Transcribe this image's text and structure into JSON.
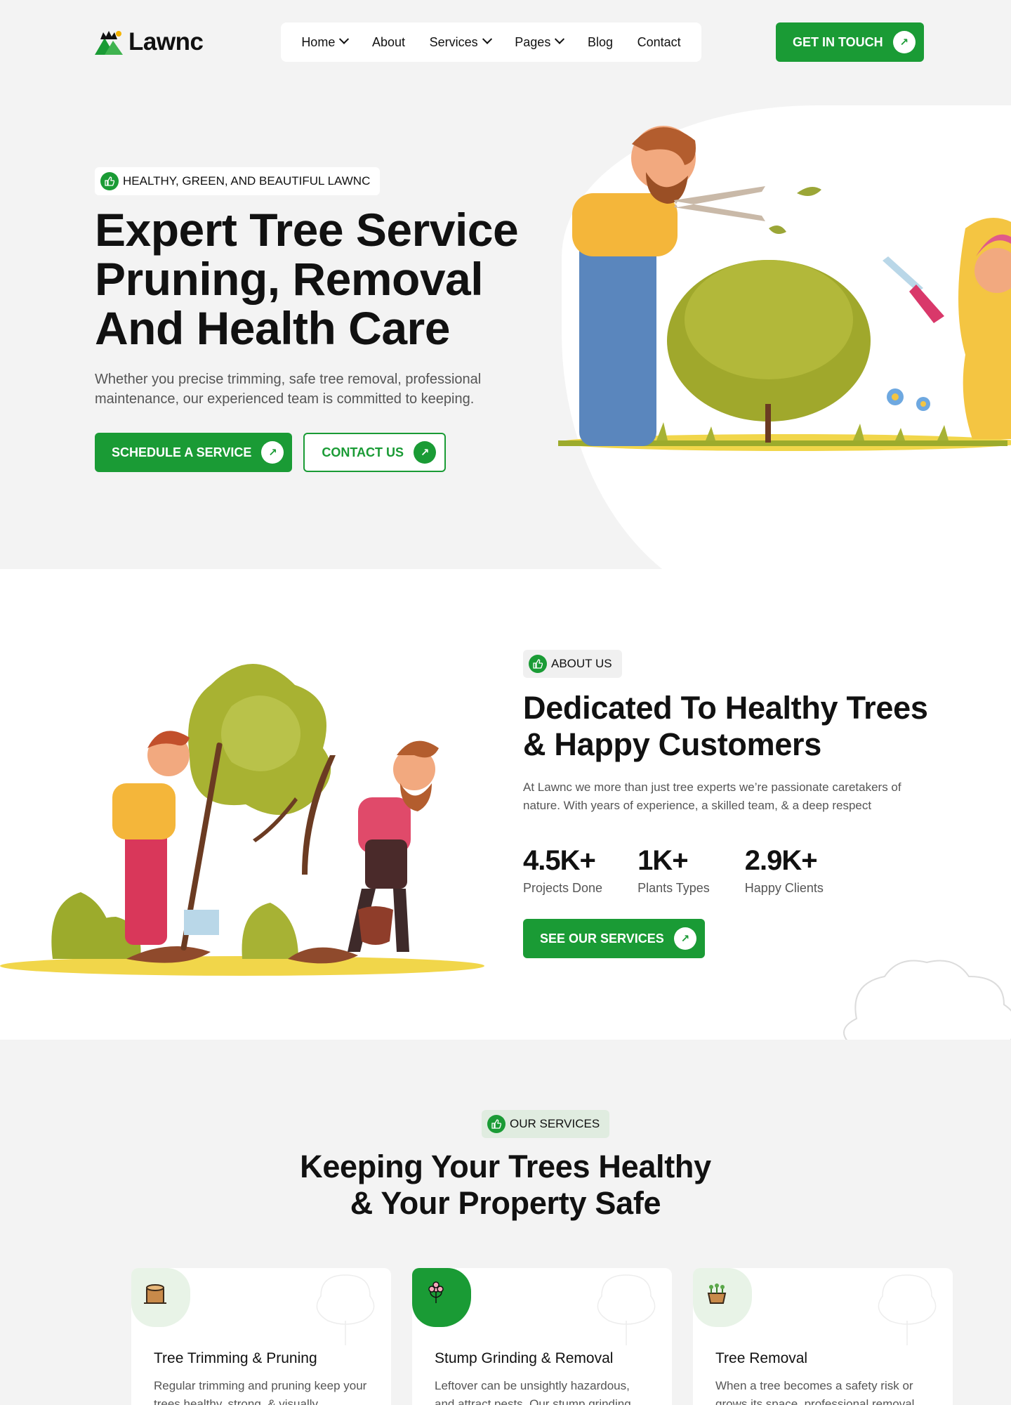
{
  "brand": {
    "name": "Lawnc"
  },
  "nav": {
    "items": [
      {
        "label": "Home",
        "dropdown": true
      },
      {
        "label": "About",
        "dropdown": false
      },
      {
        "label": "Services",
        "dropdown": true
      },
      {
        "label": "Pages",
        "dropdown": true
      },
      {
        "label": "Blog",
        "dropdown": false
      },
      {
        "label": "Contact",
        "dropdown": false
      }
    ],
    "cta_label": "GET IN TOUCH"
  },
  "hero": {
    "tag": "HEALTHY, GREEN, AND BEAUTIFUL LAWNC",
    "title_line1": "Expert Tree Service",
    "title_line2": "Pruning, Removal",
    "title_line3": "And Health Care",
    "description": "Whether you precise trimming, safe tree removal, professional maintenance, our experienced team is committed to keeping.",
    "primary_button": "SCHEDULE A SERVICE",
    "secondary_button": "CONTACT US"
  },
  "about": {
    "tag": "ABOUT US",
    "title_line1": "Dedicated To Healthy Trees",
    "title_line2": "& Happy Customers",
    "description": "At Lawnc we more than just tree experts we’re passionate caretakers of nature. With years of experience, a skilled team, & a deep respect",
    "stats": [
      {
        "value": "4.5K+",
        "label": "Projects Done"
      },
      {
        "value": "1K+",
        "label": "Plants Types"
      },
      {
        "value": "2.9K+",
        "label": "Happy Clients"
      }
    ],
    "button": "SEE OUR SERVICES"
  },
  "services": {
    "tag": "OUR SERVICES",
    "title_line1": "Keeping Your Trees Healthy",
    "title_line2": "& Your Property Safe",
    "cards": [
      {
        "title": "Tree Trimming & Pruning",
        "description": "Regular trimming and pruning keep your trees healthy, strong, & visually",
        "icon": "tree-stump-icon",
        "active": false
      },
      {
        "title": "Stump Grinding & Removal",
        "description": "Leftover can be unsightly hazardous, and attract pests. Our stump grinding",
        "icon": "flower-icon",
        "active": true
      },
      {
        "title": "Tree Removal",
        "description": "When a tree becomes a safety risk or grows its space, professional removal",
        "icon": "planter-icon",
        "active": false
      }
    ]
  },
  "colors": {
    "accent": "#1a9b35",
    "background": "#f3f3f3"
  }
}
